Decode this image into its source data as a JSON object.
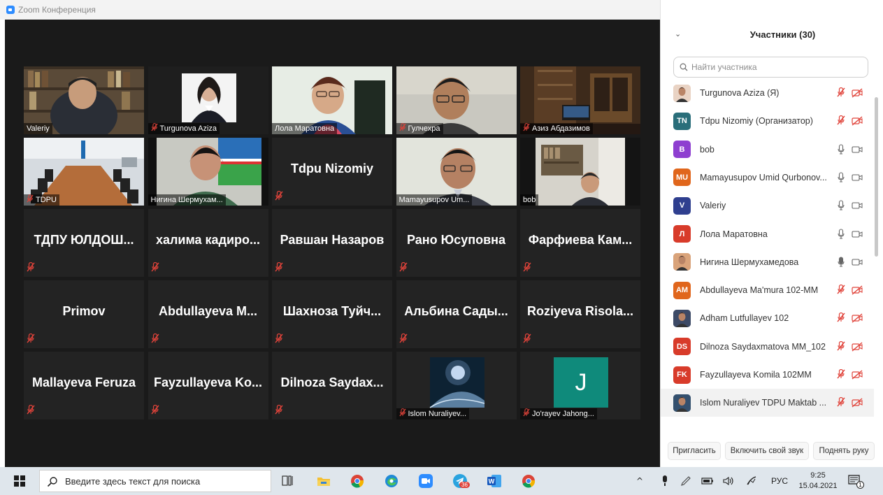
{
  "window": {
    "title": "Zoom Конференция"
  },
  "window_controls": {
    "minimize": "—",
    "maximize": "❐",
    "close": "✕"
  },
  "tiles": [
    {
      "caption": "Valeriy",
      "muted": false,
      "scene": "bookshelf"
    },
    {
      "caption": "Turgunova Aziza",
      "muted": true,
      "scene": "portrait"
    },
    {
      "caption": "Лола Маратовна",
      "muted": false,
      "scene": "woman"
    },
    {
      "caption": "Гулчехра",
      "muted": true,
      "scene": "man-office"
    },
    {
      "caption": "Азиз Абдазимов",
      "muted": true,
      "scene": "library"
    },
    {
      "caption": "TDPU",
      "muted": true,
      "scene": "boardroom"
    },
    {
      "caption": "Нигина Шермухам...",
      "muted": false,
      "scene": "woman-flag",
      "active": true
    },
    {
      "name": "Tdpu Nizomiy",
      "muted": true
    },
    {
      "caption": "Mamayusupov Um...",
      "muted": false,
      "scene": "man-glasses"
    },
    {
      "caption": "bob",
      "muted": false,
      "scene": "man-shelf"
    },
    {
      "name": "ТДПУ ЮЛДОШ...",
      "muted": true
    },
    {
      "name": "халима кадиро...",
      "muted": true
    },
    {
      "name": "Равшан Назаров",
      "muted": true
    },
    {
      "name": "Рано Юсуповна",
      "muted": true
    },
    {
      "name": "Фарфиева Кам...",
      "muted": true
    },
    {
      "name": "Primov",
      "muted": true
    },
    {
      "name": "Abdullayeva M...",
      "muted": true
    },
    {
      "name": "Шахноза Туйч...",
      "muted": true
    },
    {
      "name": "Альбина Сады...",
      "muted": true
    },
    {
      "name": "Roziyeva Risola...",
      "muted": true
    },
    {
      "name": "Mallayeva Feruza",
      "muted": true
    },
    {
      "name": "Fayzullayeva Ko...",
      "muted": true
    },
    {
      "name": "Dilnoza Saydax...",
      "muted": true
    },
    {
      "caption": "Islom Nuraliyev...",
      "muted": true,
      "scene": "moon"
    },
    {
      "caption": "Jo'rayev Jahong...",
      "muted": true,
      "scene": "letter",
      "letter": "J"
    }
  ],
  "participants_panel": {
    "title": "Участники (30)",
    "search_placeholder": "Найти участника",
    "participants": [
      {
        "name": "Turgunova Aziza (Я)",
        "avatar_text": "",
        "avatar_color": "#e9d3c4",
        "photo": true,
        "mic": "muted",
        "cam": "off"
      },
      {
        "name": "Tdpu Nizomiy (Организатор)",
        "avatar_text": "TN",
        "avatar_color": "#2a6e7a",
        "mic": "muted",
        "cam": "off"
      },
      {
        "name": "bob",
        "avatar_text": "B",
        "avatar_color": "#8e3fd0",
        "mic": "on",
        "cam": "on"
      },
      {
        "name": "Mamayusupov Umid Qurbonov...",
        "avatar_text": "MU",
        "avatar_color": "#e0661c",
        "mic": "on",
        "cam": "on"
      },
      {
        "name": "Valeriy",
        "avatar_text": "V",
        "avatar_color": "#2f3f8f",
        "mic": "on",
        "cam": "on"
      },
      {
        "name": "Лола Маратовна",
        "avatar_text": "Л",
        "avatar_color": "#d83b2a",
        "mic": "on",
        "cam": "on"
      },
      {
        "name": "Нигина Шермухамедова",
        "avatar_text": "",
        "avatar_color": "#d9a37a",
        "photo": true,
        "mic": "speaking",
        "cam": "on"
      },
      {
        "name": "Abdullayeva Ma'mura 102-MM",
        "avatar_text": "AM",
        "avatar_color": "#e0661c",
        "mic": "muted",
        "cam": "off"
      },
      {
        "name": "Adham Lutfullayev 102",
        "avatar_text": "",
        "avatar_color": "#3d4a66",
        "photo": true,
        "mic": "muted",
        "cam": "off"
      },
      {
        "name": "Dilnoza Saydaxmatova MM_102",
        "avatar_text": "DS",
        "avatar_color": "#d83b2a",
        "mic": "muted",
        "cam": "off"
      },
      {
        "name": "Fayzullayeva Komila 102MM",
        "avatar_text": "FK",
        "avatar_color": "#d83b2a",
        "mic": "muted",
        "cam": "off"
      },
      {
        "name": "Islom Nuraliyev TDPU Maktab ...",
        "avatar_text": "",
        "avatar_color": "#34506e",
        "photo": true,
        "mic": "muted",
        "cam": "off",
        "highlight": true
      }
    ],
    "buttons": {
      "invite": "Пригласить",
      "unmute": "Включить свой звук",
      "raise_hand": "Поднять руку"
    }
  },
  "taskbar": {
    "search_placeholder": "Введите здесь текст для поиска",
    "telegram_badge": "36",
    "language": "РУС",
    "time": "9:25",
    "date": "15.04.2021",
    "notification_count": "1"
  },
  "colors": {
    "zoom_blue": "#2d8cff",
    "muted_red": "#e0433a",
    "active_speaker": "#d7e35f",
    "tile_bg": "#232323"
  }
}
